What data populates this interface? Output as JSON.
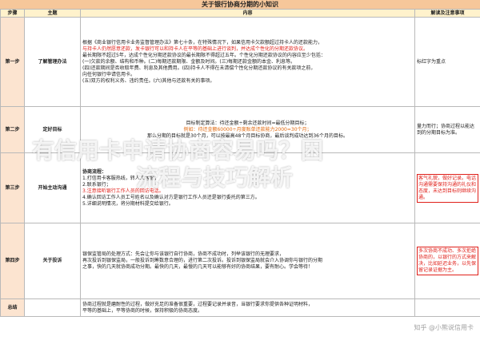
{
  "title": "关于银行协商分期的小知识",
  "headers": {
    "step": "步骤",
    "topic": "主题",
    "content": "内容",
    "tips": "解读及注意事项"
  },
  "rows": [
    {
      "step": "第一步",
      "topic": "了解管理办法",
      "lines": [
        "根据《商业银行信用卡业务监督管理办法》第七十条，在特殊情况下，如果信用卡欠款额超过持卡人的还款能力，",
        "与持卡人仍然愿意还款，发卡银行可以和持卡人在平等的基础上进行谈判，并达成个性化的分期还款协议。",
        "最长期限不超过5年，达成个性化分期还款协议的最长期限不得超过五年。个性化分期还款协议的内容应至少包括：",
        "(一)欠款的余额、结构和币种。(二)每期还款期限、金额及时间。(三)每期还款金额的本金、利息等。",
        "(四)还款期间是否收取年费、利息及其他费用。(四)持卡人不得在未清偿个性化分期还款协议的有关款项之前，",
        "向任何银行申请信用卡。",
        "(五)双方的权利义务、违约责任。(六)其他与还款有关的事项。"
      ],
      "tips": "标红字为重点"
    },
    {
      "step": "第二步",
      "topic": "定好目标",
      "lines": [
        "目标制定算法：待还金额÷剩余还款时间=最低分期目标；",
        "例如：待还金额60000÷月度账单还款能力2000=30个月；",
        "那么分期的目标就是30个月，可以按最高48个月目标协商，最后谈判成功达到36个月的目标。"
      ],
      "tips": "量力而行；协商过程以能达到的分期目标为准。"
    },
    {
      "step": "第三步",
      "topic": "开始主动沟通",
      "lines": [
        "协商流程：",
        "1.打信用卡客服热线，转人工客服；",
        "2.联系银行；",
        "3.注意接听银行工作人员的回访电话。",
        "4.确认回访工作人员工号姓名以及确认对方是银行工作人员还是银行委托的第三方。",
        "5.详细说明情况，将分期材料提交给银行。"
      ],
      "tips": "客气礼貌，做好记录。电话沟通需要保持沟通的礼仪和态度，未达到目标则继续沟通。"
    },
    {
      "step": "第四步",
      "topic": "关于投诉",
      "lines": [
        "银保监管局的处理方式：先会让你与该银行自行协商，协商不成功时，列举该银行的无理要求，",
        "再次投诉到银保监局，一般投诉到筹数意合理的，进行第二次投诉。投诉到银保监局就会介入协调你与银行的分期",
        "之事，快的几天就协商成功分期。最快的几天，最慢的几天可以能够有好的协商结果，要有耐心。学会等待！"
      ],
      "tips": "多次协商不成功、多次拒绝协商的，以银行的方式来解决，比如延迟业务，以先保留记录证据为主。"
    },
    {
      "step": "总结",
      "topic": "",
      "lines": [
        "协商过程就是磨耐性的过程，做好充足的准备很重要，过程要记录并录音，当银行要求你提供各种证明材料，",
        "平等的基础上，平等协商的时候，保持积极的协商态度。"
      ],
      "tips": ""
    }
  ],
  "overlay": {
    "line1": "有信用卡申请协商容易吗？困",
    "line2": "流程与技巧解析"
  },
  "watermark": "知乎 @小熊说信用卡"
}
